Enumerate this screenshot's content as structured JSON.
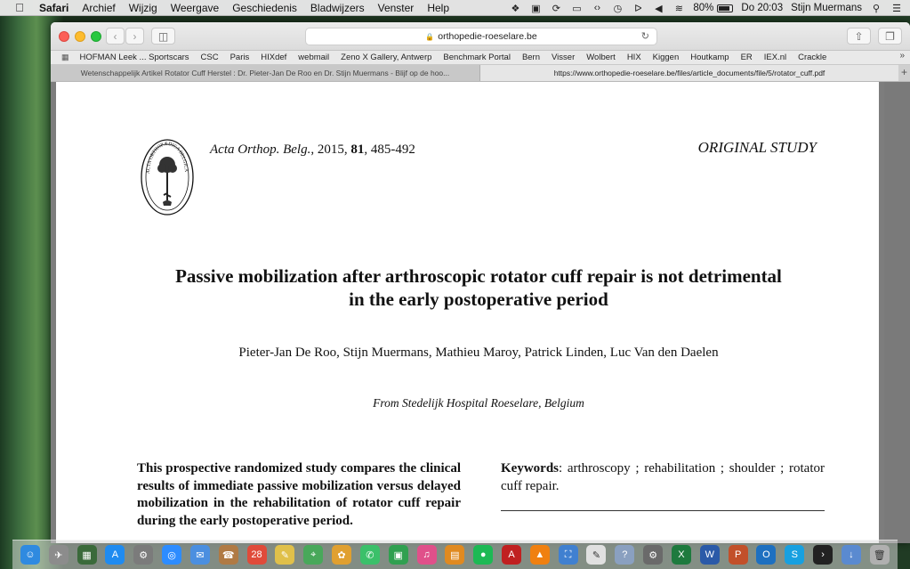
{
  "menubar": {
    "app": "Safari",
    "items": [
      "Archief",
      "Wijzig",
      "Weergave",
      "Geschiedenis",
      "Bladwijzers",
      "Venster",
      "Help"
    ],
    "battery": "80%",
    "battery_level": 0.8,
    "clock": "Do 20:03",
    "user": "Stijn Muermans"
  },
  "toolbar": {
    "url": "orthopedie-roeselare.be"
  },
  "favorites": [
    "HOFMAN Leek ... Sportscars",
    "CSC",
    "Paris",
    "HIXdef",
    "webmail",
    "Zeno X Gallery, Antwerp",
    "Benchmark Portal",
    "Bern",
    "Visser",
    "Wolbert",
    "HIX",
    "Kiggen",
    "Houtkamp",
    "ER",
    "IEX.nl",
    "Crackle"
  ],
  "tabs": [
    {
      "title": "Wetenschappelijk Artikel Rotator Cuff Herstel : Dr. Pieter-Jan De Roo en Dr. Stijn Muermans - Blijf op de hoo..."
    },
    {
      "title": "https://www.orthopedie-roeselare.be/files/article_documents/file/5/rotator_cuff.pdf"
    }
  ],
  "pdf": {
    "journal_name": "Acta Orthop",
    "journal_abbrev": ". Belg.",
    "journal_year": ", 2015, ",
    "journal_volume": "81",
    "journal_pages": ", 485-492",
    "study_type": "ORIGINAL STUDY",
    "title_line1": "Passive mobilization after arthroscopic rotator cuff repair is not detrimental",
    "title_line2": "in the early postoperative period",
    "authors": "Pieter-Jan De Roo, Stijn Muermans, Mathieu Maroy, Patrick Linden, Luc Van den Daelen",
    "affiliation": "From Stedelijk Hospital Roeselare, Belgium",
    "abstract": "This prospective randomized study compares the clinical results of immediate passive mobilization versus delayed mobilization in the rehabilitation of rotator cuff repair during the early postoperative period.",
    "keywords_label": "Keywords",
    "keywords": ": arthroscopy ; rehabilitation ; shoulder ; rotator cuff repair.",
    "logo_text": "ACTA ORTHOPÆDICA BELGICA"
  },
  "dock": {
    "icons": [
      "finder-icon",
      "launchpad-icon",
      "mission-control-icon",
      "app-store-icon",
      "system-prefs-icon",
      "safari-icon",
      "mail-icon",
      "contacts-icon",
      "calendar-icon",
      "notes-icon",
      "maps-icon",
      "photos-icon",
      "messages-icon",
      "facetime-icon",
      "itunes-icon",
      "ibooks-icon",
      "spotify-icon",
      "acrobat-icon",
      "vlc-icon",
      "preview-icon",
      "textedit-icon",
      "help-icon",
      "settings-icon",
      "excel-icon",
      "word-icon",
      "powerpoint-icon",
      "outlook-icon",
      "skype-icon",
      "terminal-icon",
      "downloads-icon",
      "trash-icon"
    ]
  }
}
